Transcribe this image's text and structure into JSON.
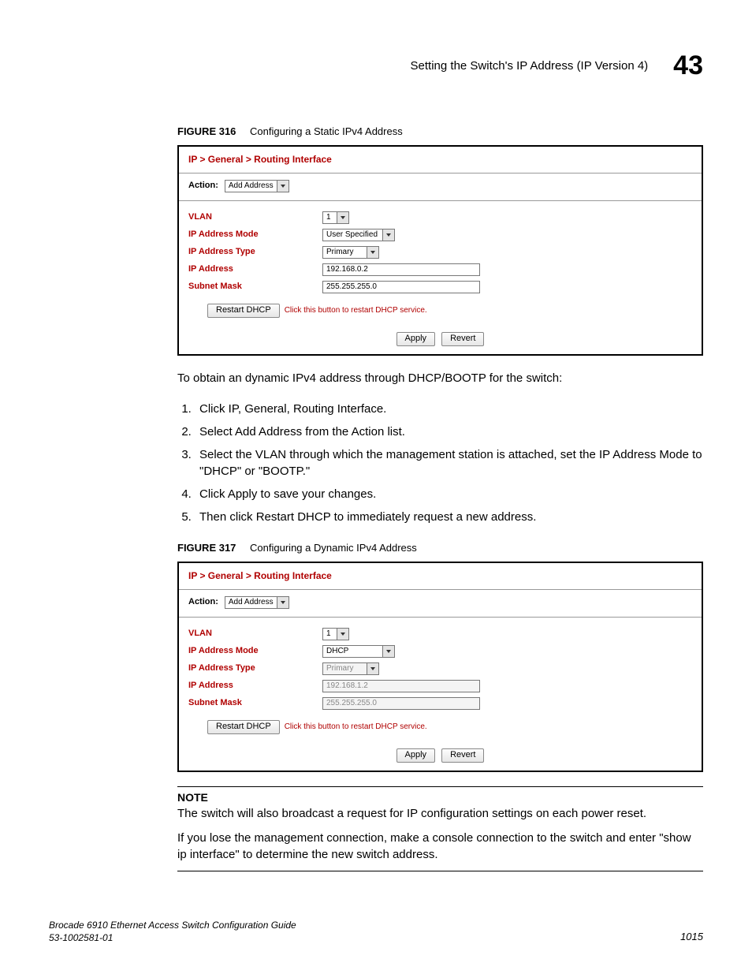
{
  "header": {
    "title": "Setting the Switch's IP Address (IP Version 4)",
    "chapter": "43"
  },
  "fig316": {
    "label": "FIGURE 316",
    "title": "Configuring a Static IPv4 Address",
    "breadcrumb": "IP > General > Routing Interface",
    "action_label": "Action:",
    "action_value": "Add Address",
    "fields": {
      "vlan_label": "VLAN",
      "vlan_value": "1",
      "mode_label": "IP Address Mode",
      "mode_value": "User Specified",
      "type_label": "IP Address Type",
      "type_value": "Primary",
      "addr_label": "IP Address",
      "addr_value": "192.168.0.2",
      "mask_label": "Subnet Mask",
      "mask_value": "255.255.255.0"
    },
    "restart_btn": "Restart DHCP",
    "restart_note": "Click this button to restart DHCP service.",
    "apply_btn": "Apply",
    "revert_btn": "Revert"
  },
  "intro_text": "To obtain an dynamic IPv4 address through DHCP/BOOTP for the switch:",
  "steps": [
    "Click IP, General, Routing Interface.",
    "Select Add Address from the Action list.",
    "Select the VLAN through which the management station is attached, set the IP Address Mode to \"DHCP\" or \"BOOTP.\"",
    "Click Apply to save your changes.",
    "Then click Restart DHCP to immediately request a new address."
  ],
  "fig317": {
    "label": "FIGURE 317",
    "title": "Configuring a Dynamic IPv4 Address",
    "breadcrumb": "IP > General > Routing Interface",
    "action_label": "Action:",
    "action_value": "Add Address",
    "fields": {
      "vlan_label": "VLAN",
      "vlan_value": "1",
      "mode_label": "IP Address Mode",
      "mode_value": "DHCP",
      "type_label": "IP Address Type",
      "type_value": "Primary",
      "addr_label": "IP Address",
      "addr_value": "192.168.1.2",
      "mask_label": "Subnet Mask",
      "mask_value": "255.255.255.0"
    },
    "restart_btn": "Restart DHCP",
    "restart_note": "Click this button to restart DHCP service.",
    "apply_btn": "Apply",
    "revert_btn": "Revert"
  },
  "note": {
    "head": "NOTE",
    "line1": "The switch will also broadcast a request for IP configuration settings on each power reset.",
    "line2": "If you lose the management connection, make a console connection to the switch and enter \"show ip interface\" to determine the new switch address."
  },
  "footer": {
    "guide": "Brocade 6910 Ethernet Access Switch Configuration Guide",
    "docnum": "53-1002581-01",
    "pagenum": "1015"
  }
}
